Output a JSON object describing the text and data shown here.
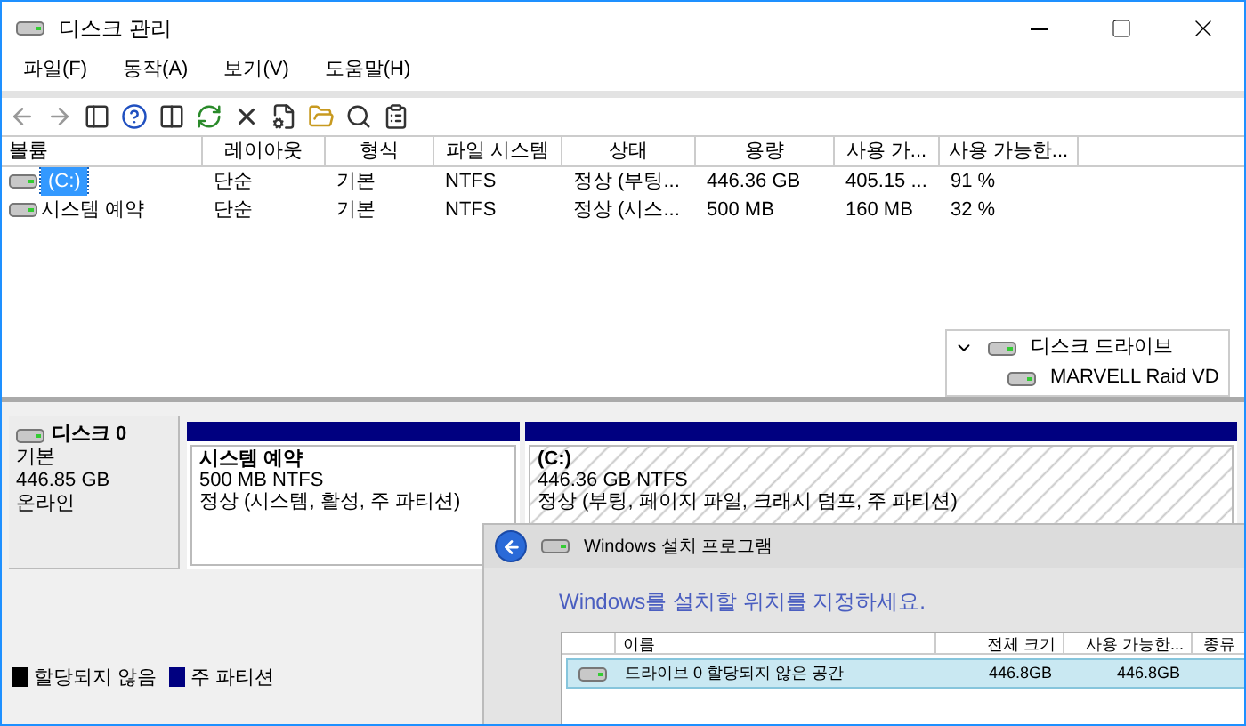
{
  "window": {
    "title": "디스크 관리"
  },
  "menu": [
    "파일(F)",
    "동작(A)",
    "보기(V)",
    "도움말(H)"
  ],
  "volume_table": {
    "columns": [
      "볼륨",
      "레이아웃",
      "형식",
      "파일 시스템",
      "상태",
      "용량",
      "사용 가...",
      "사용 가능한..."
    ],
    "rows": [
      {
        "selected": true,
        "cells": [
          "(C:)",
          "단순",
          "기본",
          "NTFS",
          "정상 (부팅...",
          "446.36 GB",
          "405.15 ...",
          "91 %"
        ]
      },
      {
        "selected": false,
        "cells": [
          "시스템 예약",
          "단순",
          "기본",
          "NTFS",
          "정상 (시스...",
          "500 MB",
          "160 MB",
          "32 %"
        ]
      }
    ]
  },
  "device_tree": {
    "label": "디스크 드라이브",
    "expanded": true,
    "children": [
      {
        "label": "MARVELL Raid VD"
      }
    ]
  },
  "disk": {
    "name": "디스크 0",
    "type": "기본",
    "size": "446.85 GB",
    "status": "온라인",
    "partitions": [
      {
        "name": "시스템 예약",
        "size": "500 MB NTFS",
        "status": "정상 (시스템, 활성, 주 파티션)",
        "selected": false
      },
      {
        "name": "(C:)",
        "size": "446.36 GB NTFS",
        "status": "정상 (부팅, 페이지 파일, 크래시 덤프, 주 파티션)",
        "selected": true
      }
    ]
  },
  "legend": [
    {
      "label": "할당되지 않음",
      "color": "#000000"
    },
    {
      "label": "주 파티션",
      "color": "#000080"
    }
  ],
  "setup_window": {
    "title": "Windows 설치 프로그램",
    "heading": "Windows를 설치할 위치를 지정하세요.",
    "columns": [
      "이름",
      "전체 크기",
      "사용 가능한...",
      "종류"
    ],
    "rows": [
      {
        "selected": true,
        "cells": [
          "드라이브 0 할당되지 않은 공간",
          "446.8GB",
          "446.8GB"
        ]
      }
    ]
  }
}
